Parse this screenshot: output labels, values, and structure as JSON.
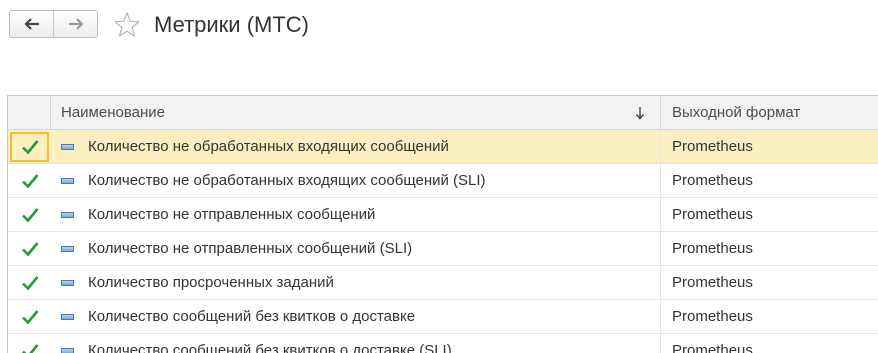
{
  "window": {
    "title": "Метрики (МТС)"
  },
  "icons": {
    "back": "arrow-left-icon",
    "forward": "arrow-right-icon",
    "favorite": "star-outline-icon",
    "sort": "sort-down-arrow-icon",
    "check": "checkmark-icon",
    "item": "list-item-icon"
  },
  "colors": {
    "check_green": "#1f9c3a",
    "selected_row": "#fbefc1",
    "selected_border": "#f0c030",
    "header_bg": "#f2f2f2"
  },
  "table": {
    "columns": {
      "name": "Наименование",
      "format": "Выходной формат"
    },
    "sort": {
      "column": "name",
      "direction": "descending"
    },
    "selected_index": 0,
    "rows": [
      {
        "checked": true,
        "name": "Количество не обработанных входящих сообщений",
        "format": "Prometheus"
      },
      {
        "checked": true,
        "name": "Количество не обработанных входящих сообщений (SLI)",
        "format": "Prometheus"
      },
      {
        "checked": true,
        "name": "Количество не отправленных сообщений",
        "format": "Prometheus"
      },
      {
        "checked": true,
        "name": "Количество не отправленных сообщений (SLI)",
        "format": "Prometheus"
      },
      {
        "checked": true,
        "name": "Количество просроченных заданий",
        "format": "Prometheus"
      },
      {
        "checked": true,
        "name": "Количество сообщений без квитков о доставке",
        "format": "Prometheus"
      },
      {
        "checked": true,
        "name": "Количество сообщений без квитков о доставке (SLI)",
        "format": "Prometheus"
      }
    ]
  }
}
